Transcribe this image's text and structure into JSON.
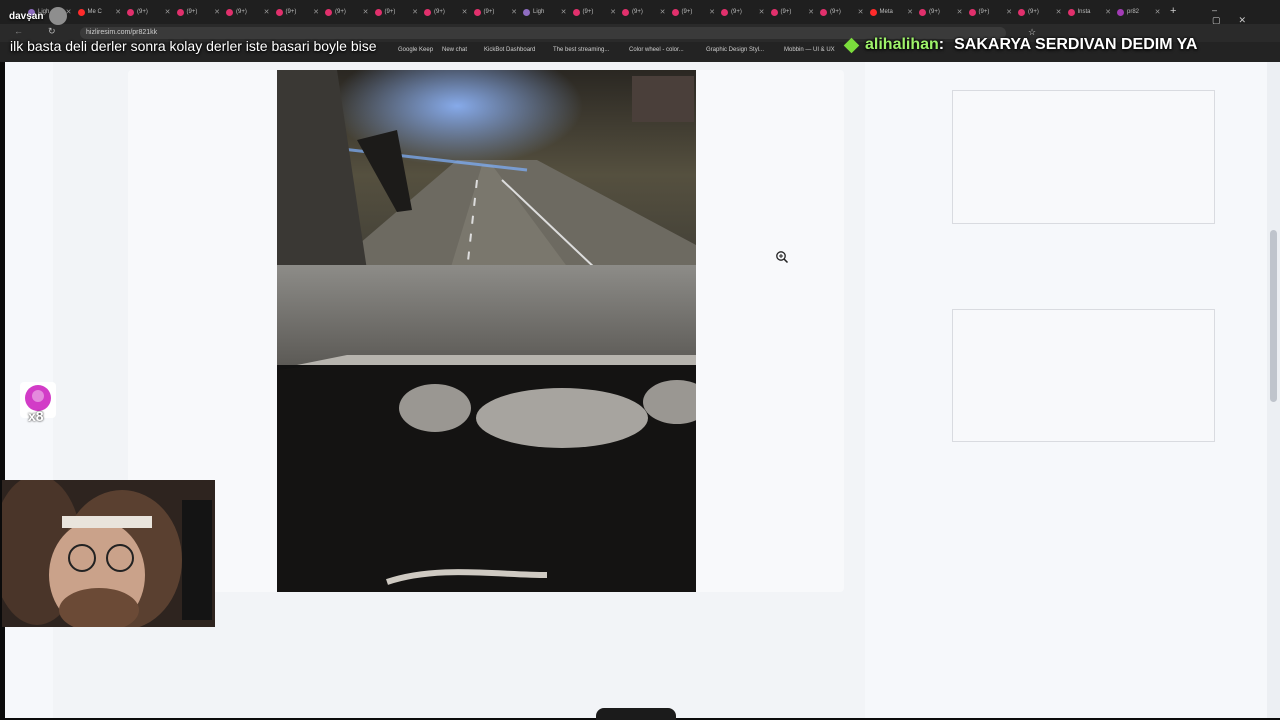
{
  "tabs": [
    {
      "label": "Ligh",
      "color": "#8e6cc1"
    },
    {
      "label": "Me C",
      "color": "#ff2b2b"
    },
    {
      "label": "(9+)",
      "color": "#e1306c"
    },
    {
      "label": "(9+)",
      "color": "#e1306c"
    },
    {
      "label": "(9+)",
      "color": "#e1306c"
    },
    {
      "label": "(9+)",
      "color": "#e1306c"
    },
    {
      "label": "(9+)",
      "color": "#e1306c"
    },
    {
      "label": "(9+)",
      "color": "#e1306c"
    },
    {
      "label": "(9+)",
      "color": "#e1306c"
    },
    {
      "label": "(9+)",
      "color": "#e1306c"
    },
    {
      "label": "Ligh",
      "color": "#8e6cc1"
    },
    {
      "label": "(9+)",
      "color": "#e1306c"
    },
    {
      "label": "(9+)",
      "color": "#e1306c"
    },
    {
      "label": "(9+)",
      "color": "#e1306c"
    },
    {
      "label": "(9+)",
      "color": "#e1306c"
    },
    {
      "label": "(9+)",
      "color": "#e1306c"
    },
    {
      "label": "(9+)",
      "color": "#e1306c"
    },
    {
      "label": "Meta",
      "color": "#ff2b2b"
    },
    {
      "label": "(9+)",
      "color": "#e1306c"
    },
    {
      "label": "(9+)",
      "color": "#e1306c"
    },
    {
      "label": "(9+)",
      "color": "#e1306c"
    },
    {
      "label": "Insta",
      "color": "#e1306c"
    },
    {
      "label": "pr82",
      "color": "#a23bb5"
    }
  ],
  "address_bar": {
    "url": "hizliresim.com/pr821kk"
  },
  "bookmarks": [
    {
      "label": "Google Keep"
    },
    {
      "label": "New chat"
    },
    {
      "label": "KickBot Dashboard"
    },
    {
      "label": "The best streaming..."
    },
    {
      "label": "Color wheel - color..."
    },
    {
      "label": "Graphic Design Styl..."
    },
    {
      "label": "Mobbin — UI & UX"
    }
  ],
  "overlay": {
    "streamer_name": "davşan",
    "stream_title": "ilk basta deli derler sonra kolay derler iste basari boyle bise",
    "chat_user": "alihalihan",
    "chat_separator": ":",
    "chat_message": "SAKARYA SERDIVAN DEDIM YA",
    "badge_count": "x8"
  },
  "icons": {
    "zoom": "zoom-in-icon",
    "new_tab": "plus-icon",
    "back": "arrow-left-icon",
    "reload": "reload-icon"
  },
  "colors": {
    "page_bg": "#f6f8fb",
    "chat_accent": "#9ef26a"
  }
}
